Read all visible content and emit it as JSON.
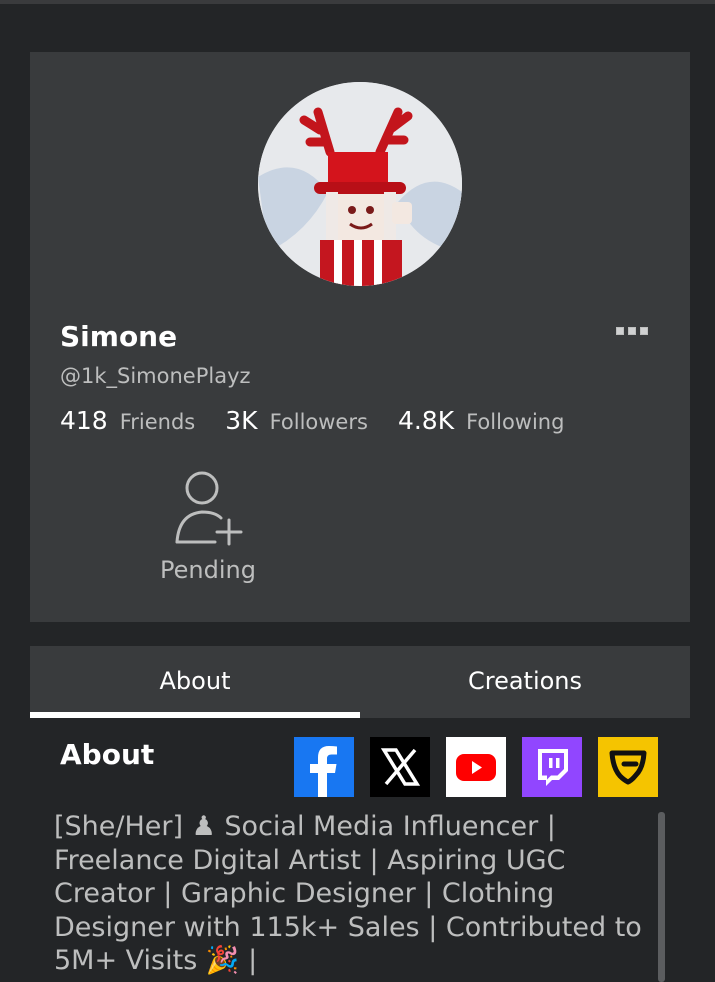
{
  "profile": {
    "display_name": "Simone",
    "username": "@1k_SimonePlayz",
    "avatar_icon": "roblox-avatar-image",
    "more_icon": "more-options-icon",
    "stats": [
      {
        "value": "418",
        "label": "Friends"
      },
      {
        "value": "3K",
        "label": "Followers"
      },
      {
        "value": "4.8K",
        "label": "Following"
      }
    ],
    "pending": {
      "label": "Pending",
      "icon": "add-friend-icon"
    }
  },
  "tabs": [
    {
      "label": "About",
      "active": true
    },
    {
      "label": "Creations",
      "active": false
    }
  ],
  "about": {
    "heading": "About",
    "socials": [
      {
        "name": "facebook",
        "icon": "facebook-icon",
        "color": "#1877f2"
      },
      {
        "name": "x",
        "icon": "x-icon",
        "color": "#000000"
      },
      {
        "name": "youtube",
        "icon": "youtube-icon",
        "color": "#ffffff"
      },
      {
        "name": "twitch",
        "icon": "twitch-icon",
        "color": "#9146ff"
      },
      {
        "name": "guilded",
        "icon": "guilded-icon",
        "color": "#f5c400"
      }
    ],
    "bio": "[She/Her] ♟ Social Media Influencer | Freelance Digital Artist | Aspiring UGC Creator | Graphic Designer | Clothing Designer with 115k+ Sales | Contributed to 5M+ Visits 🎉 |"
  },
  "colors": {
    "background": "#232527",
    "card": "#393b3d",
    "text_primary": "#ffffff",
    "text_secondary": "#bdbebe"
  }
}
